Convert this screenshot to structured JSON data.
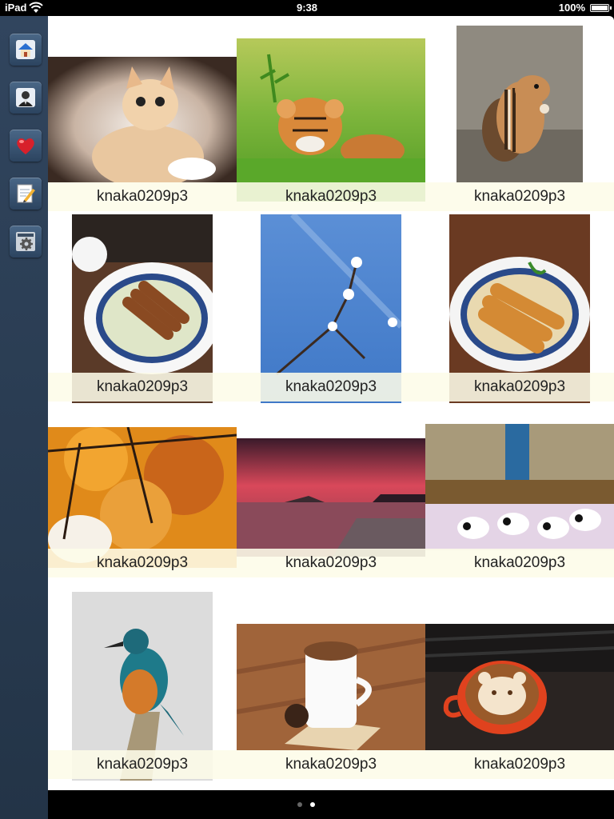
{
  "status_bar": {
    "device": "iPad",
    "time": "9:38",
    "battery": "100%",
    "battery_level": 1.0
  },
  "sidebar": {
    "items": [
      {
        "name": "home-button",
        "icon": "home-icon"
      },
      {
        "name": "user-button",
        "icon": "user-icon"
      },
      {
        "name": "favorites-button",
        "icon": "heart-icon"
      },
      {
        "name": "edit-button",
        "icon": "notepad-pencil-icon"
      },
      {
        "name": "settings-button",
        "icon": "gear-icon"
      }
    ]
  },
  "grid": {
    "items": [
      {
        "subject": "kitten",
        "caption": "knaka0209p3"
      },
      {
        "subject": "tiger-cub",
        "caption": "knaka0209p3"
      },
      {
        "subject": "chipmunk",
        "caption": "knaka0209p3"
      },
      {
        "subject": "katsu-plate",
        "caption": "knaka0209p3"
      },
      {
        "subject": "plum-blossom-sky",
        "caption": "knaka0209p3"
      },
      {
        "subject": "tonkatsu-plate",
        "caption": "knaka0209p3"
      },
      {
        "subject": "autumn-leaves",
        "caption": "knaka0209p3"
      },
      {
        "subject": "sunset-pier",
        "caption": "knaka0209p3"
      },
      {
        "subject": "panda-cubs",
        "caption": "knaka0209p3"
      },
      {
        "subject": "kingfisher",
        "caption": "knaka0209p3"
      },
      {
        "subject": "coffee-cup",
        "caption": "knaka0209p3"
      },
      {
        "subject": "bear-latte-art",
        "caption": "knaka0209p3"
      }
    ]
  },
  "page_control": {
    "pages": 2,
    "current_page": 2
  }
}
